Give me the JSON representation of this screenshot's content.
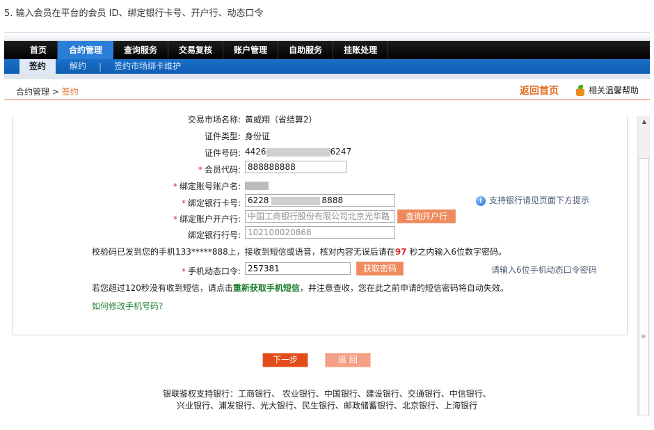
{
  "caption": "5. 输入会员在平台的会员 ID、绑定银行卡号、开户行、动态口令",
  "nav": {
    "main": [
      "首页",
      "合约管理",
      "查询服务",
      "交易复核",
      "账户管理",
      "自助服务",
      "挂账处理"
    ],
    "active_main": "合约管理",
    "sub_active": "签约",
    "sub_1": "解约",
    "sub_sep": "|",
    "sub_2": "签约市场绑卡维护"
  },
  "breadcrumb": {
    "parent": "合约管理",
    "arrow": ">",
    "current": "签约"
  },
  "home_link": "返回首页",
  "help_link": "相关温馨帮助",
  "form": {
    "market_label": "交易市场名称:",
    "market_value": "黄威翔（省结算2）",
    "id_type_label": "证件类型:",
    "id_type_value": "身份证",
    "id_no_label": "证件号码:",
    "id_no_prefix": "4426",
    "id_no_suffix": "6247",
    "member_label": "会员代码:",
    "member_value": "888888888",
    "acct_name_label": "绑定账号账户名:",
    "card_label": "绑定银行卡号:",
    "card_prefix": "6228",
    "card_suffix": "8888",
    "bank_label": "绑定账户开户行:",
    "bank_value": "中国工商银行股份有限公司北京光华路",
    "bank_btn": "查询开户行",
    "bank_no_label": "绑定银行行号:",
    "bank_no_value": "102100020868",
    "support_hint": "支持银行请见页面下方提示",
    "otp_label": "手机动态口令:",
    "otp_value": "257381",
    "otp_btn": "获取密码",
    "otp_hint": "请输入6位手机动态口令密码"
  },
  "sms_notice": {
    "part1": "校验码已发到您的手机133*****888上，接收到短信或语音，核对内容无误后请在",
    "seconds": "97",
    "part2": "秒之内输入6位数字密码。"
  },
  "resend_notice": {
    "part1": "若您超过120秒没有收到短信，请点击",
    "link": "重新获取手机短信",
    "part2": "，并注意查收，您在此之前申请的短信密码将自动失效。"
  },
  "modify_phone_link": "如何修改手机号码?",
  "buttons": {
    "next": "下一步",
    "back": "返 回"
  },
  "footer": {
    "line1": "银联鉴权支持银行：工商银行、 农业银行、中国银行、建设银行、交通银行、中信银行、",
    "line2": "兴业银行、浦发银行、光大银行、民生银行、邮政储蓄银行、北京银行、上海银行"
  },
  "colors": {
    "accent_orange": "#e36c1f",
    "nav_blue": "#2a7ed8",
    "button_red": "#e34c1a",
    "required": "#e02a2a"
  }
}
